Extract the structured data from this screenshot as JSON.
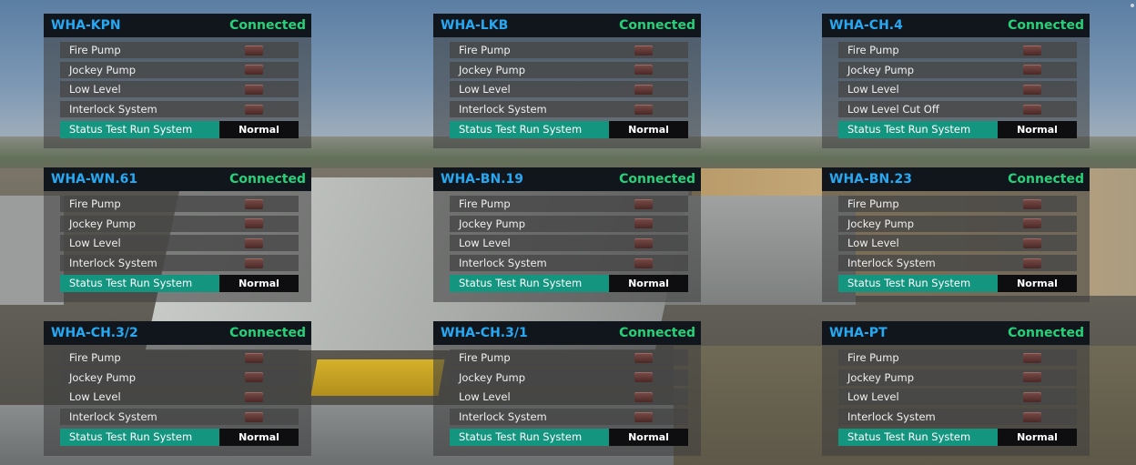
{
  "colors": {
    "title": "#27a8f2",
    "connected": "#27d17a",
    "status_bar": "#14957f",
    "header_bg": "#10161c"
  },
  "panels": [
    {
      "title": "WHA-KPN",
      "connection": "Connected",
      "rows": [
        "Fire Pump",
        "Jockey Pump",
        "Low Level",
        "Interlock System"
      ],
      "status_label": "Status Test Run System",
      "status_value": "Normal"
    },
    {
      "title": "WHA-LKB",
      "connection": "Connected",
      "rows": [
        "Fire Pump",
        "Jockey Pump",
        "Low Level",
        "Interlock System"
      ],
      "status_label": "Status Test Run System",
      "status_value": "Normal"
    },
    {
      "title": "WHA-CH.4",
      "connection": "Connected",
      "rows": [
        "Fire Pump",
        "Jockey Pump",
        "Low Level",
        "Low Level Cut Off"
      ],
      "status_label": "Status Test Run System",
      "status_value": "Normal"
    },
    {
      "title": "WHA-WN.61",
      "connection": "Connected",
      "rows": [
        "Fire Pump",
        "Jockey Pump",
        "Low Level",
        "Interlock System"
      ],
      "status_label": "Status Test Run System",
      "status_value": "Normal"
    },
    {
      "title": "WHA-BN.19",
      "connection": "Connected",
      "rows": [
        "Fire Pump",
        "Jockey Pump",
        "Low Level",
        "Interlock System"
      ],
      "status_label": "Status Test Run System",
      "status_value": "Normal"
    },
    {
      "title": "WHA-BN.23",
      "connection": "Connected",
      "rows": [
        "Fire Pump",
        "Jockey Pump",
        "Low Level",
        "Interlock System"
      ],
      "status_label": "Status Test Run System",
      "status_value": "Normal"
    },
    {
      "title": "WHA-CH.3/2",
      "connection": "Connected",
      "rows": [
        "Fire Pump",
        "Jockey Pump",
        "Low Level",
        "Interlock System"
      ],
      "status_label": "Status Test Run System",
      "status_value": "Normal"
    },
    {
      "title": "WHA-CH.3/1",
      "connection": "Connected",
      "rows": [
        "Fire Pump",
        "Jockey Pump",
        "Low Level",
        "Interlock System"
      ],
      "status_label": "Status Test Run System",
      "status_value": "Normal"
    },
    {
      "title": "WHA-PT",
      "connection": "Connected",
      "rows": [
        "Fire Pump",
        "Jockey Pump",
        "Low Level",
        "Interlock System"
      ],
      "status_label": "Status Test Run System",
      "status_value": "Normal"
    }
  ]
}
